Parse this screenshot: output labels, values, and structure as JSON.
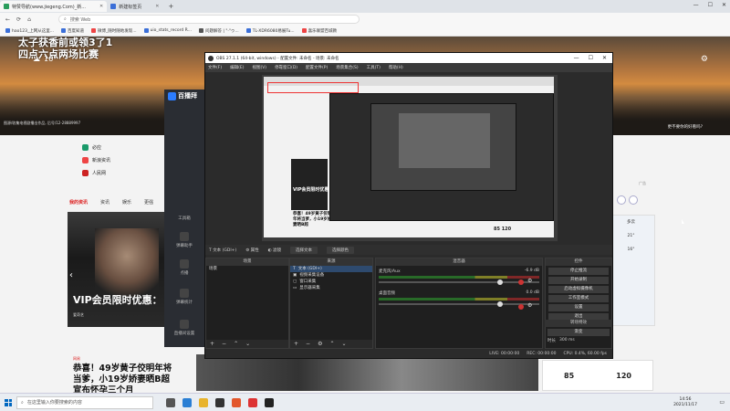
{
  "browser": {
    "tabs": [
      {
        "label": "特赞导航(www.jiegeng.Com)_新...",
        "active": true
      },
      {
        "label": "新建标签页",
        "active": false
      }
    ],
    "new_tab": "+",
    "window_controls": [
      "—",
      "☐",
      "✕"
    ],
    "address_placeholder": "搜索 Web",
    "bookmarks": [
      "hao123_上网从这里...",
      "百度知道",
      "微博_随时随地发现...",
      "uio_stats_record R...",
      "问题解答 | \"·\"ゥ...",
      "TL-XDR6080易展Tu...",
      "喜乐联盟百城教"
    ]
  },
  "hero": {
    "headline_line1": "太子获香前或领3了1",
    "headline_line2": "四点六点两场比赛",
    "temperature": "16°",
    "caption": "图源/收集电视剧播出作品, 后号/12-28889997",
    "right_link": "更不要你的好看吗?"
  },
  "page": {
    "quick_links": [
      "必应",
      "新浪资讯",
      "人民网"
    ],
    "news_tabs": [
      "我的资讯",
      "资讯",
      "娱乐",
      "更强"
    ],
    "vip_card": {
      "badge": "爱奇艺",
      "title": "VIP会员限时优惠：",
      "sub": "爱奇艺"
    },
    "headline_tag": "网易",
    "headline": "恭喜！49岁黄子佼明年将\n当爹，小19岁娇妻晒B超\n宣布怀孕三个月",
    "ad_label": "广告",
    "weather": [
      "多云",
      "21°",
      "16°"
    ],
    "sports": {
      "left": "85",
      "right": "120"
    }
  },
  "live_app": {
    "logo": "百播拜",
    "tools_label": "工具箱",
    "items": [
      "弹幕助手",
      "点播",
      "弹幕统计",
      "直播间设置"
    ]
  },
  "obs": {
    "title": "OBS 27.1.1 (64-bit, windows) - 配置文件: 未命名 - 场景: 未命名",
    "window_controls": [
      "—",
      "☐",
      "✕"
    ],
    "menu": [
      "文件(F)",
      "编辑(E)",
      "视图(V)",
      "停靠窗口(D)",
      "配置文件(P)",
      "场景集合(S)",
      "工具(T)",
      "帮助(H)"
    ],
    "preview": {
      "vip": "VIP会员限时优惠",
      "headline": "恭喜！49岁黄子佼明年将当爹，小19岁娇妻晒B超",
      "score": "85 120"
    },
    "source_bar": {
      "source_name": "文本 (GDI+)",
      "props": "属性",
      "filter": "滤镜",
      "b1": "选择文本",
      "b2": "选择颜色"
    },
    "scenes": {
      "header": "场景",
      "items": [
        "场景"
      ]
    },
    "sources": {
      "header": "来源",
      "items": [
        "文本 (GDI+)",
        "视频采集设备",
        "窗口采集",
        "显示器采集"
      ]
    },
    "mixer": {
      "header": "混音器",
      "channels": [
        {
          "name": "麦克风/Aux",
          "db": "-6.9 dB"
        },
        {
          "name": "桌面音频",
          "db": "0.0 dB"
        }
      ]
    },
    "controls": {
      "header": "控件",
      "buttons": [
        "停止推流",
        "开始录制",
        "启动虚拟摄像机",
        "工作室模式",
        "设置",
        "退出"
      ]
    },
    "transitions": {
      "header": "转场特效",
      "mode": "渐变",
      "duration_label": "时长",
      "duration": "300 ms"
    },
    "status": [
      "LIVE: 00:00:00",
      "REC: 00:00:00",
      "CPU: 0.4%, 60.00 fps"
    ]
  },
  "taskbar": {
    "search_placeholder": "在这里输入你要搜索的内容",
    "time": "14:56",
    "date": "2021/11/17"
  }
}
